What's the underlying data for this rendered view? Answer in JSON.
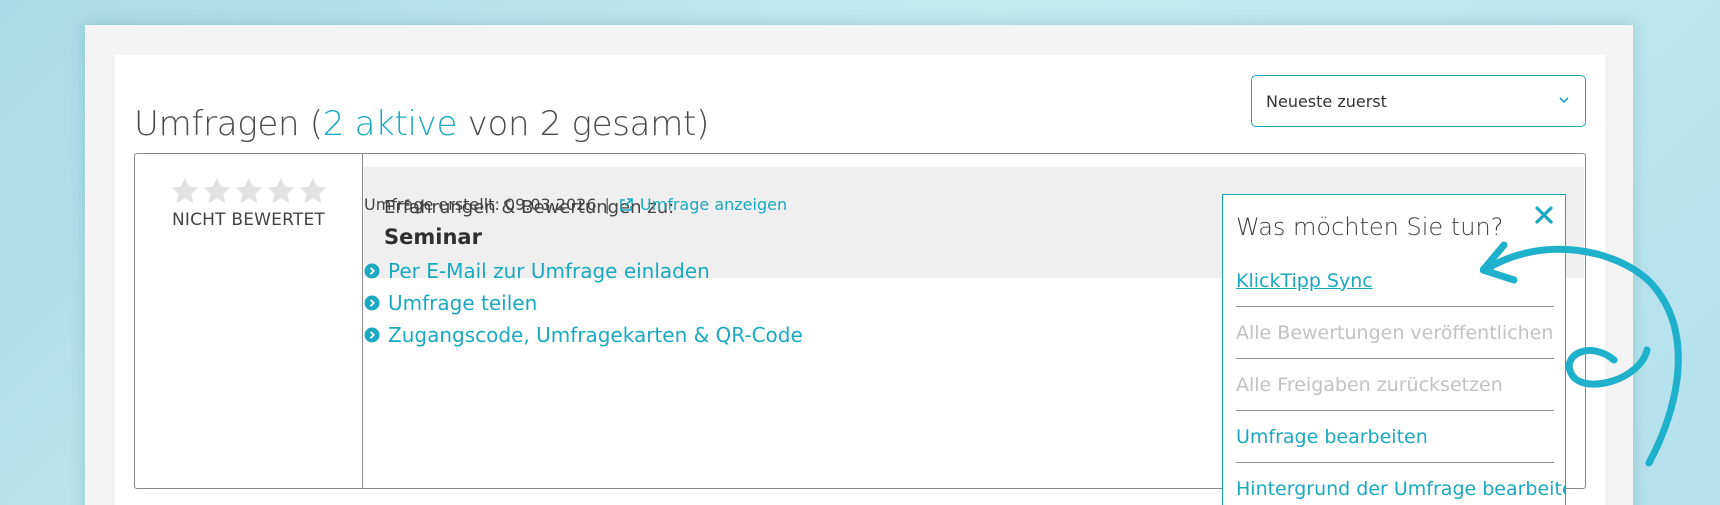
{
  "header": {
    "title_prefix": "Umfragen (",
    "title_active": "2 aktive",
    "title_suffix": " von 2 gesamt)"
  },
  "sort": {
    "selected": "Neueste zuerst",
    "icon": "chevron-down-icon"
  },
  "survey": {
    "rating": {
      "stars_filled": 0,
      "stars_total": 5,
      "label": "NICHT BEWERTET"
    },
    "subtitle": "Erfahrungen & Bewertungen zu:",
    "title": "Seminar",
    "created": "Umfrage erstellt: 09.03.2026",
    "separator": "|",
    "view_link": "Umfrage anzeigen",
    "actions": [
      {
        "label": "Per E-Mail zur Umfrage einladen",
        "icon": "chevron-circle-icon"
      },
      {
        "label": "Umfrage teilen",
        "icon": "chevron-circle-icon"
      },
      {
        "label": "Zugangscode, Umfragekarten & QR-Code",
        "icon": "chevron-circle-icon"
      }
    ]
  },
  "popup": {
    "title": "Was möchten Sie tun?",
    "close_icon": "close-icon",
    "items": [
      {
        "label": "KlickTipp Sync",
        "state": "active"
      },
      {
        "label": "Alle Bewertungen veröffentlichen",
        "state": "disabled"
      },
      {
        "label": "Alle Freigaben zurücksetzen",
        "state": "disabled"
      },
      {
        "label": "Umfrage bearbeiten",
        "state": "active"
      },
      {
        "label": "Hintergrund der Umfrage bearbeiten",
        "state": "active"
      }
    ]
  },
  "colors": {
    "accent": "#1aa9c0",
    "star_empty": "#e2e2e2",
    "disabled_text": "#c2c2c2"
  }
}
